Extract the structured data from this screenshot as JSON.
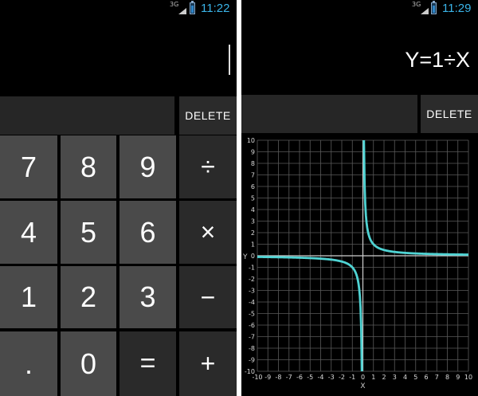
{
  "left_phone": {
    "status": {
      "network": "3G",
      "time": "11:22"
    },
    "delete_label": "DELETE",
    "keys": {
      "k7": "7",
      "k8": "8",
      "k9": "9",
      "div": "÷",
      "k4": "4",
      "k5": "5",
      "k6": "6",
      "mul": "×",
      "k1": "1",
      "k2": "2",
      "k3": "3",
      "sub": "−",
      "dot": ".",
      "k0": "0",
      "eq": "=",
      "add": "+"
    }
  },
  "right_phone": {
    "status": {
      "network": "3G",
      "time": "11:29"
    },
    "formula": "Y=1÷X",
    "delete_label": "DELETE",
    "graph": {
      "x_axis_label": "X",
      "y_axis_label": "Y",
      "x_tick_labels": [
        "-10",
        "-9",
        "-8",
        "-7",
        "-6",
        "-5",
        "-4",
        "-3",
        "-2",
        "-1",
        "0",
        "1",
        "2",
        "3",
        "4",
        "5",
        "6",
        "7",
        "8",
        "9",
        "10"
      ],
      "y_tick_labels": [
        "10",
        "9",
        "8",
        "7",
        "6",
        "5",
        "4",
        "3",
        "2",
        "1",
        "0",
        "-1",
        "-2",
        "-3",
        "-4",
        "-5",
        "-6",
        "-7",
        "-8",
        "-9",
        "-10"
      ]
    }
  },
  "chart_data": {
    "type": "line",
    "title": "",
    "xlabel": "X",
    "ylabel": "Y",
    "xlim": [
      -10,
      10
    ],
    "ylim": [
      -10,
      10
    ],
    "grid": true,
    "series": [
      {
        "color": "#4fd3d3",
        "x": [
          -10,
          -8,
          -6,
          -4,
          -3,
          -2,
          -1.5,
          -1,
          -0.75,
          -0.5,
          -0.35,
          -0.25,
          -0.2,
          -0.15,
          -0.12,
          -0.1
        ],
        "y": [
          -0.1,
          -0.125,
          -0.167,
          -0.25,
          -0.333,
          -0.5,
          -0.667,
          -1,
          -1.333,
          -2,
          -2.857,
          -4,
          -5,
          -6.667,
          -8.333,
          -10
        ]
      },
      {
        "color": "#4fd3d3",
        "x": [
          0.1,
          0.12,
          0.15,
          0.2,
          0.25,
          0.35,
          0.5,
          0.75,
          1,
          1.5,
          2,
          3,
          4,
          6,
          8,
          10
        ],
        "y": [
          10,
          8.333,
          6.667,
          5,
          4,
          2.857,
          2,
          1.333,
          1,
          0.667,
          0.5,
          0.333,
          0.25,
          0.167,
          0.125,
          0.1
        ]
      }
    ]
  }
}
